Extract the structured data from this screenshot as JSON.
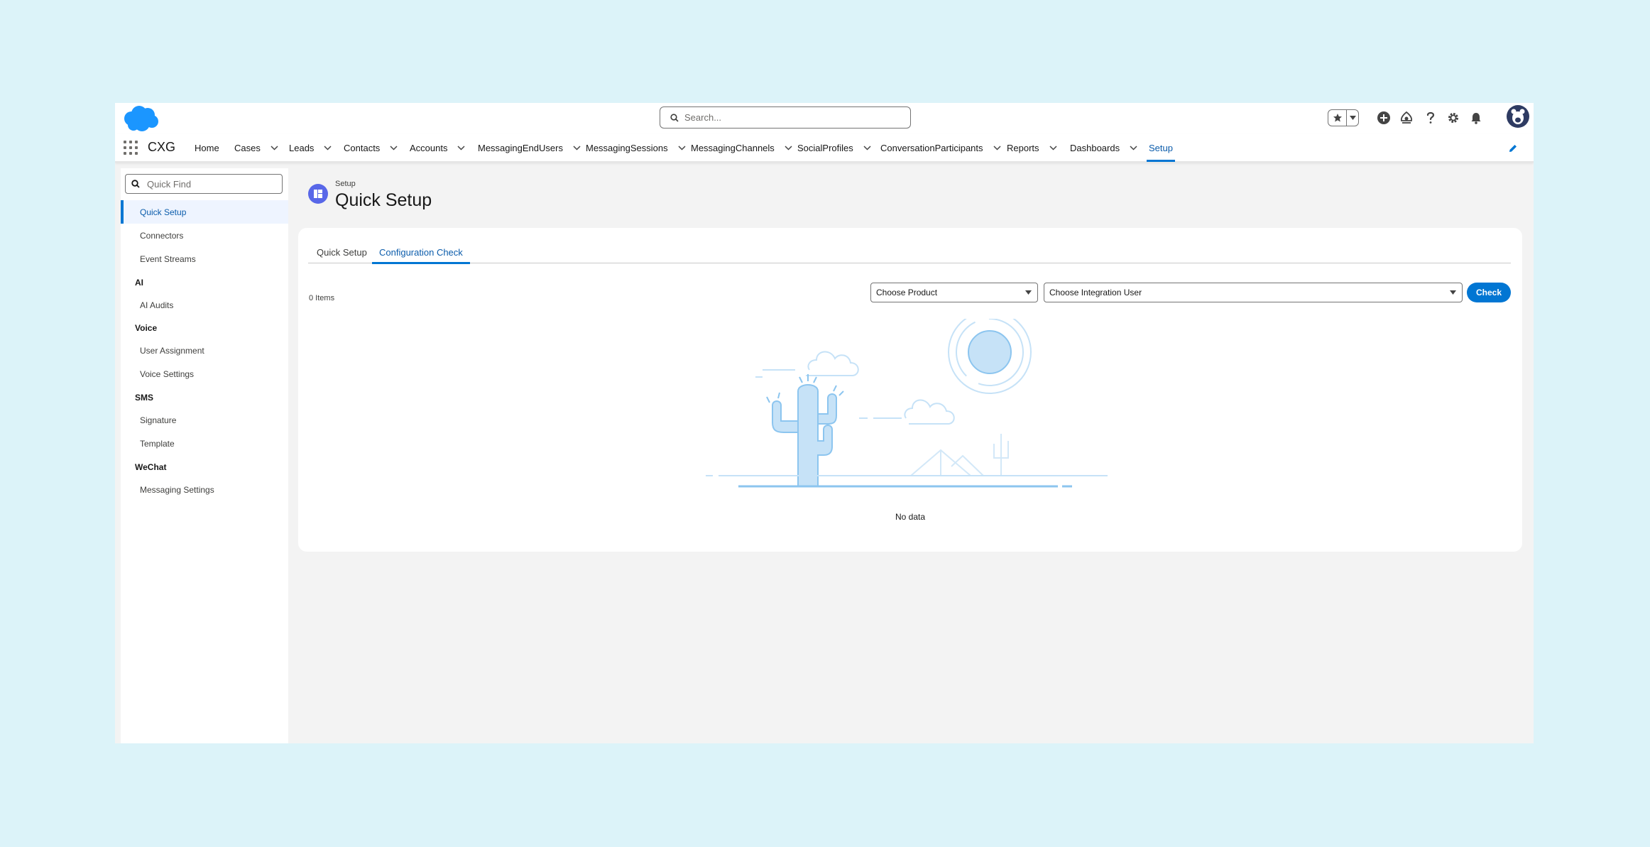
{
  "header": {
    "search_placeholder": "Search..."
  },
  "nav": {
    "app_name": "CXG",
    "items": [
      {
        "label": "Home"
      },
      {
        "label": "Cases"
      },
      {
        "label": "Leads"
      },
      {
        "label": "Contacts"
      },
      {
        "label": "Accounts"
      },
      {
        "label": "MessagingEndUsers"
      },
      {
        "label": "MessagingSessions"
      },
      {
        "label": "MessagingChannels"
      },
      {
        "label": "SocialProfiles"
      },
      {
        "label": "ConversationParticipants"
      },
      {
        "label": "Reports"
      },
      {
        "label": "Dashboards"
      },
      {
        "label": "Setup"
      }
    ]
  },
  "sidebar": {
    "quick_find_placeholder": "Quick Find",
    "items": [
      {
        "label": "Quick Setup"
      },
      {
        "label": "Connectors"
      },
      {
        "label": "Event Streams"
      },
      {
        "label": "AI Audits"
      },
      {
        "label": "User Assignment"
      },
      {
        "label": "Voice Settings"
      },
      {
        "label": "Signature"
      },
      {
        "label": "Template"
      },
      {
        "label": "Messaging Settings"
      }
    ],
    "sections": [
      "AI",
      "Voice",
      "SMS",
      "WeChat"
    ]
  },
  "page": {
    "breadcrumb": "Setup",
    "title": "Quick Setup",
    "tabs": [
      {
        "label": "Quick Setup"
      },
      {
        "label": "Configuration Check"
      }
    ],
    "items_count": "0 Items",
    "product_select": "Choose Product",
    "user_select": "Choose Integration User",
    "check_button": "Check",
    "empty_text": "No data"
  },
  "colors": {
    "accent": "#0176d3",
    "brand_cloud": "#1b96ff",
    "background": "#dcf3f9"
  }
}
